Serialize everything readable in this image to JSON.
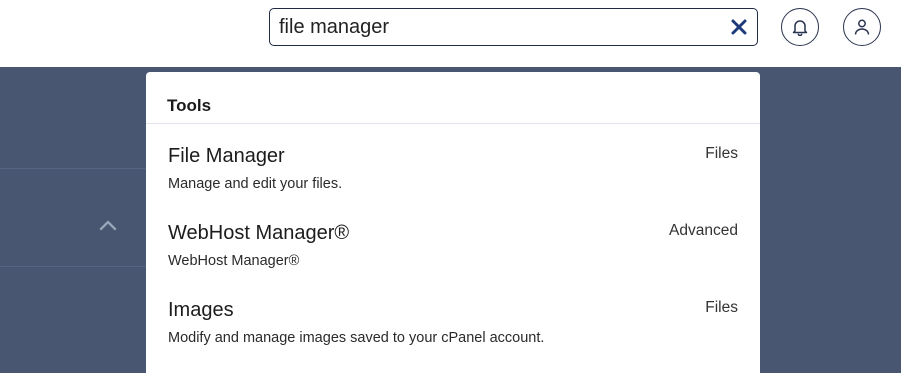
{
  "search": {
    "value": "file manager",
    "clear_icon": "close-icon"
  },
  "header": {
    "notifications_icon": "bell-icon",
    "account_icon": "user-icon"
  },
  "sidebar": {
    "collapse_icon": "chevron-up-icon"
  },
  "results": {
    "section_title": "Tools",
    "items": [
      {
        "title": "File Manager",
        "description": "Manage and edit your files.",
        "category": "Files"
      },
      {
        "title": "WebHost Manager®",
        "description": "WebHost Manager®",
        "category": "Advanced"
      },
      {
        "title": "Images",
        "description": "Modify and manage images saved to your cPanel account.",
        "category": "Files"
      }
    ]
  },
  "colors": {
    "background": "#485672",
    "accent": "#1f3a7a",
    "panel": "#ffffff"
  }
}
